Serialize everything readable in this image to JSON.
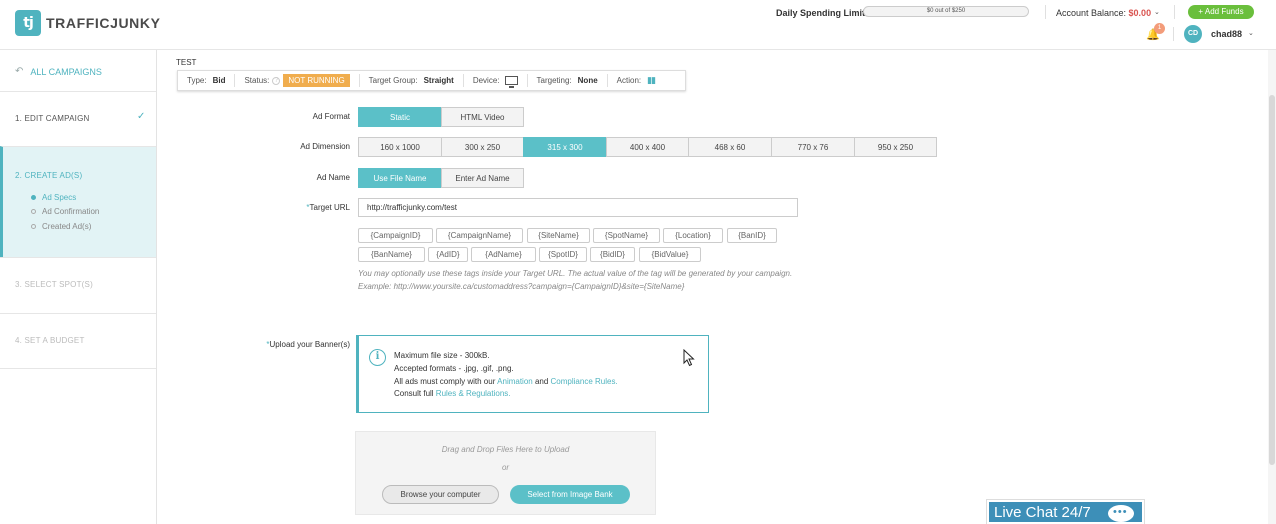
{
  "header": {
    "brand": "TRAFFICJUNKY",
    "brand_mark": "tj",
    "spending_label": "Daily Spending Limit:",
    "spending_value": "$0 out of $250",
    "balance_label": "Account Balance: ",
    "balance_value": "$0.00",
    "add_funds": "+ Add Funds",
    "notification_count": "1",
    "avatar_initials": "CD",
    "username": "chad88"
  },
  "sidebar": {
    "back_label": "ALL CAMPAIGNS",
    "steps": [
      {
        "label": "1. EDIT CAMPAIGN"
      },
      {
        "label": "2. CREATE AD(S)"
      },
      {
        "label": "3. SELECT SPOT(S)"
      },
      {
        "label": "4. SET A BUDGET"
      }
    ],
    "substeps": [
      {
        "label": "Ad Specs"
      },
      {
        "label": "Ad Confirmation"
      },
      {
        "label": "Created Ad(s)"
      }
    ]
  },
  "campaign": {
    "name": "TEST",
    "type_label": "Type:",
    "type_value": "Bid",
    "status_label": "Status:",
    "status_value": "NOT RUNNING",
    "target_group_label": "Target Group:",
    "target_group_value": "Straight",
    "device_label": "Device:",
    "targeting_label": "Targeting:",
    "targeting_value": "None",
    "action_label": "Action:"
  },
  "form": {
    "ad_format_label": "Ad Format",
    "ad_formats": [
      "Static",
      "HTML Video"
    ],
    "ad_dimension_label": "Ad Dimension",
    "ad_dimensions": [
      "160 x 1000",
      "300 x 250",
      "315 x 300",
      "400 x 400",
      "468 x 60",
      "770 x 76",
      "950 x 250"
    ],
    "ad_name_label": "Ad Name",
    "ad_name_options": [
      "Use File Name",
      "Enter Ad Name"
    ],
    "target_url_label": "Target URL",
    "target_url_value": "http://trafficjunky.com/test",
    "tags_row1": [
      "{CampaignID}",
      "{CampaignName}",
      "{SiteName}",
      "{SpotName}",
      "{Location}",
      "{BanID}"
    ],
    "tags_row2": [
      "{BanName}",
      "{AdID}",
      "{AdName}",
      "{SpotID}",
      "{BidID}",
      "{BidValue}"
    ],
    "hint_line1": "You may optionally use these tags inside your Target URL. The actual value of the tag will be generated by your campaign.",
    "hint_line2": "Example: http://www.yoursite.ca/customaddress?campaign={CampaignID}&site={SiteName}",
    "upload_label": "Upload your Banner(s)",
    "upload_info": {
      "line1_prefix": "Maximum file size - ",
      "line1_value": "300kB.",
      "line2": "Accepted formats - .jpg, .gif, .png.",
      "line3_prefix": "All ads must comply with our ",
      "line3_link1": "Animation",
      "line3_mid": " and ",
      "line3_link2": "Compliance Rules.",
      "line4_prefix": "Consult full ",
      "line4_link": "Rules & Regulations."
    },
    "drop_text": "Drag and Drop Files Here to Upload",
    "or_text": "or",
    "browse_button": "Browse your computer",
    "image_bank_button": "Select from Image Bank"
  },
  "live_chat": "Live Chat 24/7",
  "colors": {
    "accent": "#4fb3bf",
    "button_on": "#5bc0c8",
    "status": "#f0ad4e",
    "add_funds": "#6abf3c",
    "balance": "#d9534f"
  }
}
